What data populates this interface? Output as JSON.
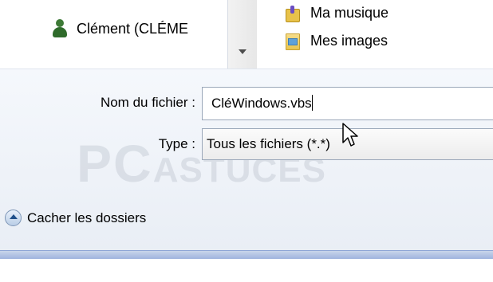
{
  "navigation": {
    "user_item": "Clément (CLÉME",
    "folders": [
      {
        "label": "Ma musique",
        "icon": "music-folder-icon"
      },
      {
        "label": "Mes images",
        "icon": "pictures-folder-icon"
      }
    ]
  },
  "form": {
    "filename_label": "Nom du fichier :",
    "filename_value": "CléWindows.vbs",
    "type_label": "Type :",
    "type_value": "Tous les fichiers (*.*)"
  },
  "footer": {
    "hide_folders_label": "Cacher les dossiers"
  },
  "watermark": {
    "part1": "PC",
    "part2": "ASTUCES"
  },
  "colors": {
    "dialog_bg": "#eef2f8",
    "bottom_band": "#9fb3de",
    "field_border": "#9ba8ba"
  }
}
